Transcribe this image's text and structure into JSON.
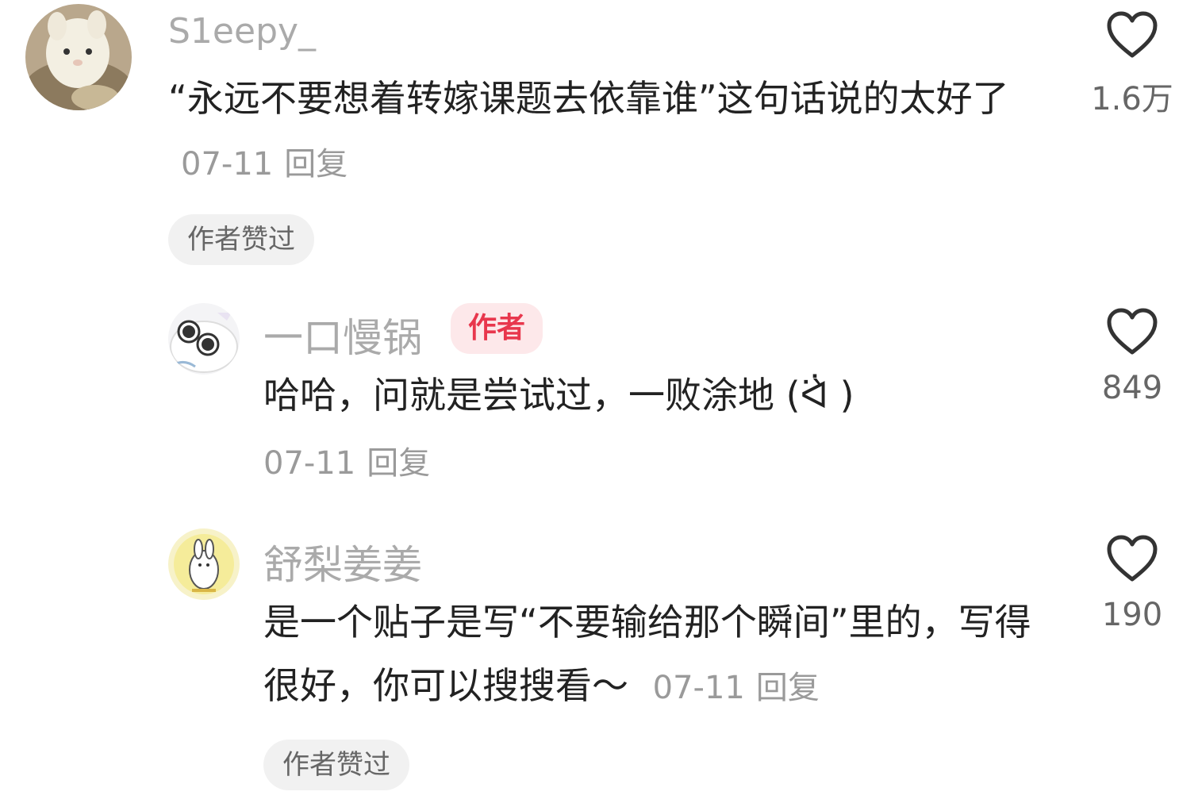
{
  "comments": [
    {
      "username": "S1eepy_",
      "text": "“永远不要想着转嫁课题去依靠谁”这句话说的太好了",
      "date": "07-11",
      "reply": "回复",
      "tag": "作者赞过",
      "likes": "1.6万"
    },
    {
      "username": "一口慢锅",
      "badge": "作者",
      "text": "哈哈，问就是尝试过，一败涂地 (ᐛ̀ )",
      "date": "07-11",
      "reply": "回复",
      "likes": "849"
    },
    {
      "username": "舒梨姜姜",
      "text": "是一个贴子是写“不要输给那个瞬间”里的，写得很好，你可以搜搜看～",
      "date": "07-11",
      "reply": "回复",
      "tag": "作者赞过",
      "likes": "190"
    }
  ],
  "colors": {
    "username": "#aaaaaa",
    "text": "#222222",
    "meta": "#9a9a9a",
    "badge_bg": "#fde8ea",
    "badge_text": "#e8374d"
  },
  "icons": {
    "like": "heart-outline-icon"
  }
}
